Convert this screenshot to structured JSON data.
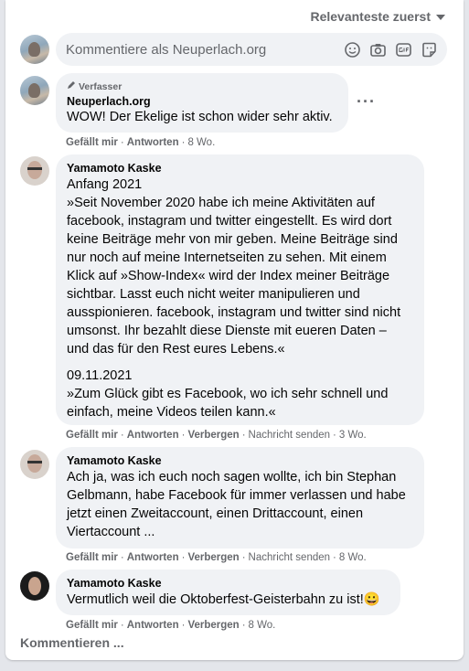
{
  "sort": {
    "label": "Relevanteste zuerst"
  },
  "composer": {
    "placeholder": "Kommentiere als Neuperlach.org"
  },
  "comments": [
    {
      "badge": "Verfasser",
      "author": "Neuperlach.org",
      "text": "WOW! Der Ekelige ist schon wider sehr aktiv.",
      "actions": {
        "like": "Gefällt mir",
        "reply": "Antworten",
        "time": "8 Wo."
      }
    },
    {
      "author": "Yamamoto Kaske",
      "text": "Anfang 2021\n»Seit November 2020 habe ich meine Aktivitäten auf\nfacebook, instagram und twitter eingestellt. Es wird dort\nkeine Beiträge mehr von mir geben. Meine Beiträge sind\nnur noch auf meine Internetseiten zu sehen. Mit einem\nKlick auf »Show-Index« wird der Index meiner Beiträge\nsichtbar. Lasst euch nicht weiter manipulieren und\nausspionieren. facebook, instagram und twitter sind nicht\numsonst. Ihr bezahlt diese Dienste mit eueren Daten –\nund das für den Rest eures Lebens.«",
      "text2": "09.11.2021\n»Zum Glück gibt es Facebook, wo ich sehr schnell und\neinfach, meine Videos teilen kann.«",
      "actions": {
        "like": "Gefällt mir",
        "reply": "Antworten",
        "hide": "Verbergen",
        "message": "Nachricht senden",
        "time": "3 Wo."
      }
    },
    {
      "author": "Yamamoto Kaske",
      "text": "Ach ja, was ich euch noch sagen wollte, ich bin Stephan\nGelbmann, habe Facebook für immer verlassen und habe\njetzt einen Zweitaccount, einen Drittaccount, einen\nViertaccount ...",
      "actions": {
        "like": "Gefällt mir",
        "reply": "Antworten",
        "hide": "Verbergen",
        "message": "Nachricht senden",
        "time": "8 Wo."
      }
    },
    {
      "author": "Yamamoto Kaske",
      "text": "Vermutlich weil die Oktoberfest-Geisterbahn zu ist!",
      "emoji": "😀",
      "actions": {
        "like": "Gefällt mir",
        "reply": "Antworten",
        "hide": "Verbergen",
        "time": "8 Wo."
      }
    }
  ],
  "footer": {
    "label": "Kommentieren ..."
  },
  "icons": [
    "emoji-icon",
    "camera-icon",
    "gif-icon",
    "sticker-icon",
    "pencil-icon",
    "more-options-icon",
    "chevron-down-icon"
  ],
  "colors": {
    "bubble": "#f0f2f5",
    "meta_text": "#65676b",
    "background": "#e4e6eb"
  }
}
